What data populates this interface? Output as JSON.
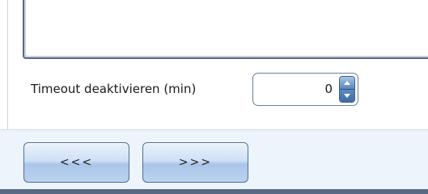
{
  "settings": {
    "timeout_label": "Timeout deaktivieren (min)",
    "timeout_value": "0"
  },
  "nav": {
    "back_label": "<<<",
    "next_label": ">>>"
  },
  "icons": {
    "spin_up": "chevron-up-icon",
    "spin_down": "chevron-down-icon"
  },
  "colors": {
    "footer_background": "#eef4fb",
    "button_gradient_top": "#eaf2fc",
    "button_gradient_bottom": "#a9c5e8",
    "spin_button_blue": "#5a86bd"
  }
}
